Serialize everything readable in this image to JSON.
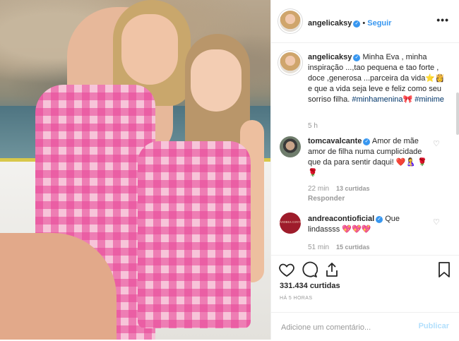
{
  "header": {
    "username": "angelicaksy",
    "separator": "•",
    "follow_label": "Seguir",
    "more_icon": "more-options-icon"
  },
  "caption": {
    "username": "angelicaksy",
    "text": "Minha Eva , minha inspiração ...,tao pequena e tao forte , doce ,generosa ...parceira da vida⭐👸 e que a vida seja leve e feliz como seu sorriso filha.",
    "hashtag1": "#minhamenina🎀",
    "hashtag2": "#minime",
    "time": "5 h"
  },
  "comments": [
    {
      "username": "tomcavalcante",
      "text": "Amor de mãe amor de filha numa cumplicidade que da para sentir daqui! ❤️🤱 🌹🌹",
      "time": "22 min",
      "likes": "13 curtidas",
      "reply": "Responder"
    },
    {
      "username": "andreacontioficial",
      "text": "Que lindassss 💖💖💖",
      "time": "51 min",
      "likes": "15 curtidas",
      "avatar_text": "ANDREA CONTI"
    }
  ],
  "actions": {
    "likes": "331.434 curtidas",
    "posted_ago": "HÁ 5 HORAS"
  },
  "comment_box": {
    "placeholder": "Adicione um comentário...",
    "post_label": "Publicar"
  },
  "colors": {
    "link_blue": "#3897f0",
    "verified_blue": "#3897f0",
    "muted_gray": "#999999",
    "disabled_post_blue": "#b2dffc"
  }
}
